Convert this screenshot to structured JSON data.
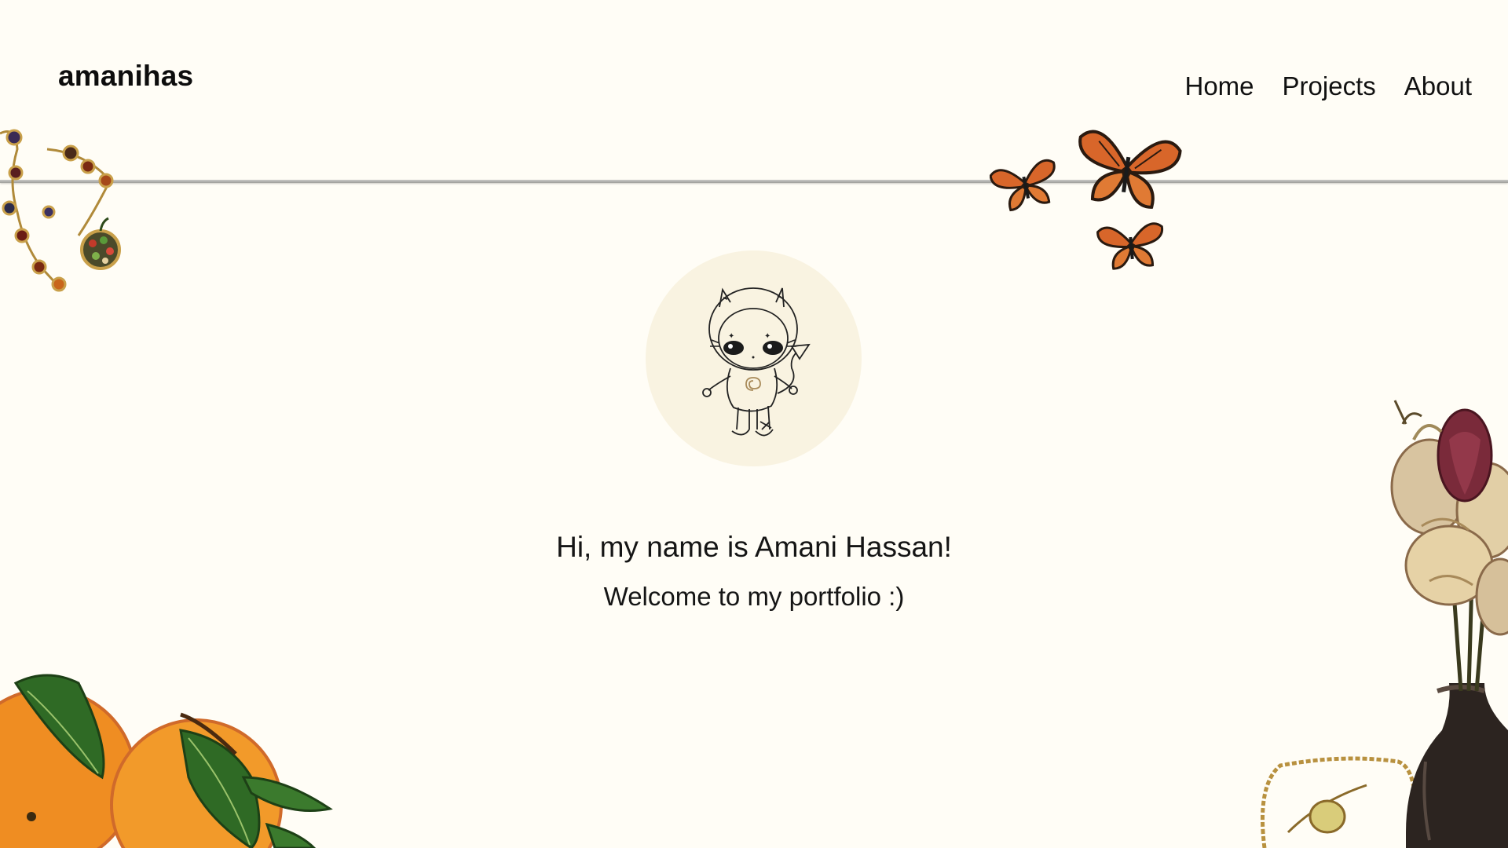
{
  "header": {
    "brand": "amanihas",
    "nav": [
      {
        "label": "Home"
      },
      {
        "label": "Projects"
      },
      {
        "label": "About"
      }
    ]
  },
  "hero": {
    "greeting": "Hi, my name is Amani Hassan!",
    "welcome": "Welcome to my portfolio :)"
  },
  "colors": {
    "background": "#fffdf6",
    "avatar_bg": "#f9f3e1",
    "butterfly": "#d8662a",
    "orange": "#ef8d22",
    "leaf": "#2f6a25"
  },
  "icons": [
    "bead-necklace-icon",
    "butterfly-icon",
    "orange-fruit-icon",
    "dried-roses-icon",
    "avatar-illustration"
  ]
}
